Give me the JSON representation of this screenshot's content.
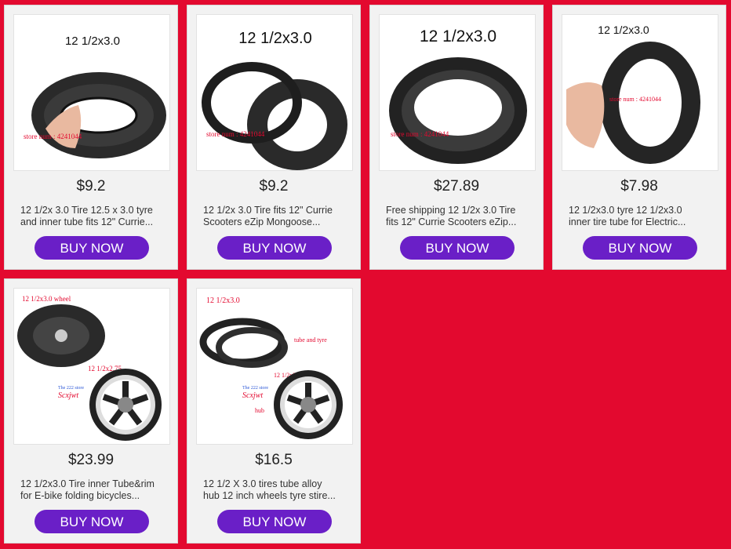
{
  "colors": {
    "background": "#e3092f",
    "button": "#6a1fc7",
    "card": "#f2f2f2"
  },
  "products": [
    {
      "image_caption": "12 1/2x3.0",
      "watermark": "store num : 4241044",
      "price": "$9.2",
      "desc_line1": "12 1/2x 3.0 Tire 12.5 x 3.0 tyre",
      "desc_line2": "and inner tube fits 12\" Currie...",
      "button": "BUY NOW"
    },
    {
      "image_caption": "12 1/2x3.0",
      "watermark": "store num : 4241044",
      "price": "$9.2",
      "desc_line1": "12 1/2x 3.0 Tire fits 12\" Currie",
      "desc_line2": "Scooters eZip Mongoose...",
      "button": "BUY NOW"
    },
    {
      "image_caption": "12 1/2x3.0",
      "watermark": "store num : 4241044",
      "price": "$27.89",
      "desc_line1": "Free shipping 12 1/2x 3.0 Tire",
      "desc_line2": "fits 12\" Currie Scooters eZip...",
      "button": "BUY NOW"
    },
    {
      "image_caption": "12 1/2x3.0",
      "watermark": "store num : 4241044",
      "price": "$7.98",
      "desc_line1": "12 1/2x3.0 tyre 12 1/2x3.0",
      "desc_line2": "inner tire tube for Electric...",
      "button": "BUY NOW"
    },
    {
      "image_caption": "12 1/2x3.0 wheel",
      "image_caption2": "12 1/2x2.75",
      "store_label": "The 222 store",
      "store_name": "Scxjwt",
      "price": "$23.99",
      "desc_line1": "12 1/2x3.0 Tire inner Tube&rim",
      "desc_line2": "for E-bike folding bicycles...",
      "button": "BUY NOW"
    },
    {
      "image_caption": "12 1/2x3.0",
      "image_caption2": "12 1/2x2.75",
      "tube_label": "tube and tyre",
      "hub_label": "hub",
      "store_label": "The 222 store",
      "store_name": "Scxjwt",
      "price": "$16.5",
      "desc_line1": "12 1/2 X 3.0 tires tube alloy",
      "desc_line2": "hub 12 inch wheels tyre stire...",
      "button": "BUY NOW"
    }
  ]
}
